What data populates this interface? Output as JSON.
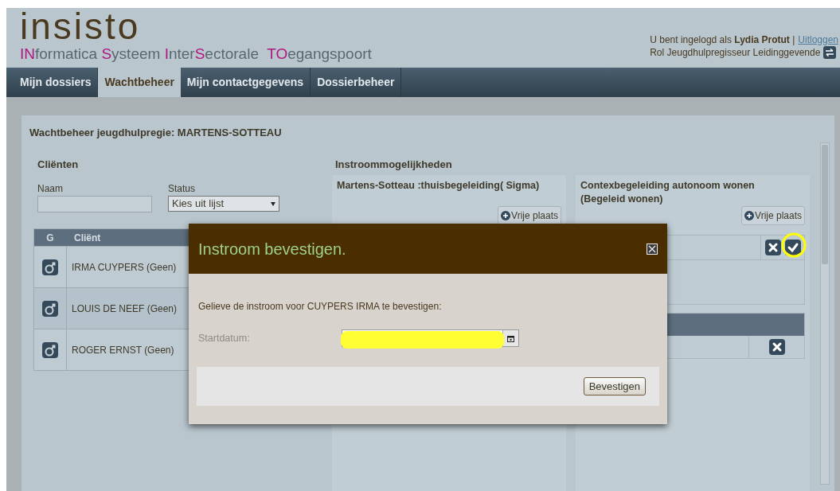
{
  "header": {
    "wordmark": "insisto",
    "tagline": [
      {
        "text": "IN",
        "accent": true
      },
      {
        "text": "formatica ",
        "accent": false
      },
      {
        "text": "S",
        "accent": true
      },
      {
        "text": "ysteem ",
        "accent": false
      },
      {
        "text": "I",
        "accent": true
      },
      {
        "text": "nter",
        "accent": false
      },
      {
        "text": "S",
        "accent": true
      },
      {
        "text": "ectorale  ",
        "accent": false
      },
      {
        "text": "TO",
        "accent": true
      },
      {
        "text": "egangspoort",
        "accent": false
      }
    ],
    "user": {
      "login": "U bent ingelogd als **Lydia Protut** |",
      "logout": "Uitloggen",
      "role": "Rol Jeugdhulpregisseur Leidinggevende"
    }
  },
  "tabs": [
    {
      "label": "Mijn dossiers",
      "selected": false
    },
    {
      "label": "Wachtbeheer",
      "selected": true
    },
    {
      "label": "Mijn contactgegevens",
      "selected": false
    },
    {
      "label": "Dossierbeheer",
      "selected": false
    }
  ],
  "panel": {
    "title": "Wachtbeheer jeugdhulpregie: MARTENS-SOTTEAU",
    "clients": {
      "heading": "Cliënten",
      "name_label": "Naam",
      "status_label": "Status",
      "status_value": "Kies uit lijst",
      "columns": [
        "G",
        "Cliënt"
      ],
      "rows": [
        {
          "name": "IRMA CUYPERS (Geen)"
        },
        {
          "name": "LOUIS DE NEEF (Geen)"
        },
        {
          "name": "ROGER ERNST (Geen)"
        }
      ]
    },
    "intake": {
      "heading": "Instroommogelijkheden",
      "columns": [
        {
          "title": "Martens-Sotteau :thuisbegeleiding( Sigma)",
          "button": "Vrije plaats"
        },
        {
          "title": "Contexbegeleiding autonoom wonen (Begeleid wonen)",
          "button": "Vrije plaats",
          "slots": [
            {
              "kind": "pending",
              "highlighted": true
            },
            {
              "kind": "occupied",
              "highlighted": false
            }
          ]
        }
      ]
    }
  },
  "dialog": {
    "title": "Instroom bevestigen.",
    "message": "Gelieve de instroom voor CUYPERS IRMA te bevestigen:",
    "field_label": "Startdatum:",
    "value_redacted": true,
    "button": "Bevestigen"
  }
}
